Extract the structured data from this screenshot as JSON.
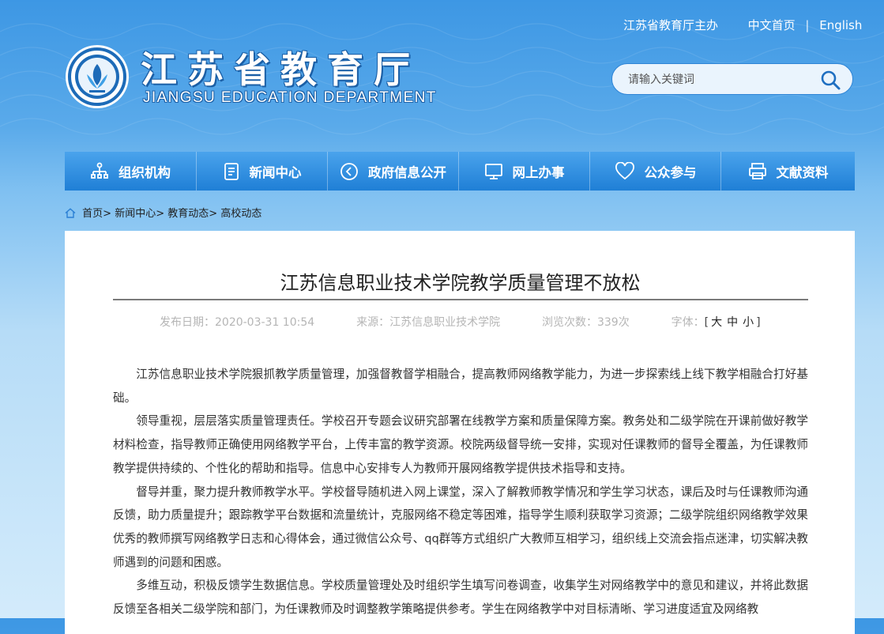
{
  "header": {
    "host_label": "江苏省教育厅主办",
    "home_cn": "中文首页",
    "separator": "|",
    "english": "English",
    "site_name": "江苏省教育厅",
    "site_name_en": "JIANGSU EDUCATION DEPARTMENT",
    "search_placeholder": "请输入关键词"
  },
  "nav": [
    {
      "label": "组织机构",
      "icon": "org-chart-icon"
    },
    {
      "label": "新闻中心",
      "icon": "document-icon"
    },
    {
      "label": "政府信息公开",
      "icon": "speaker-icon"
    },
    {
      "label": "网上办事",
      "icon": "monitor-icon"
    },
    {
      "label": "公众参与",
      "icon": "heart-icon"
    },
    {
      "label": "文献资料",
      "icon": "printer-icon"
    }
  ],
  "breadcrumb": {
    "home": "首页",
    "items": [
      "新闻中心",
      "教育动态",
      "高校动态"
    ],
    "sep": ">"
  },
  "article": {
    "title": "江苏信息职业技术学院教学质量管理不放松",
    "date_label": "发布日期：",
    "date": "2020-03-31 10:54",
    "source_label": "来源：",
    "source": "江苏信息职业技术学院",
    "views_label": "浏览次数：",
    "views": "339次",
    "font_label": "字体：",
    "font_sizes": [
      "大",
      "中",
      "小"
    ],
    "paragraphs": [
      "江苏信息职业技术学院狠抓教学质量管理，加强督教督学相融合，提高教师网络教学能力，为进一步探索线上线下教学相融合打好基础。",
      "领导重视，层层落实质量管理责任。学校召开专题会议研究部署在线教学方案和质量保障方案。教务处和二级学院在开课前做好教学材料检查，指导教师正确使用网络教学平台，上传丰富的教学资源。校院两级督导统一安排，实现对任课教师的督导全覆盖，为任课教师教学提供持续的、个性化的帮助和指导。信息中心安排专人为教师开展网络教学提供技术指导和支持。",
      "督导并重，聚力提升教师教学水平。学校督导随机进入网上课堂，深入了解教师教学情况和学生学习状态，课后及时与任课教师沟通反馈，助力质量提升；跟踪教学平台数据和流量统计，克服网络不稳定等困难，指导学生顺利获取学习资源；二级学院组织网络教学效果优秀的教师撰写网络教学日志和心得体会，通过微信公众号、qq群等方式组织广大教师互相学习，组织线上交流会指点迷津，切实解决教师遇到的问题和困惑。",
      "多维互动，积极反馈学生数据信息。学校质量管理处及时组织学生填写问卷调查，收集学生对网络教学中的意见和建议，并将此数据反馈至各相关二级学院和部门，为任课教师及时调整教学策略提供参考。学生在网络教学中对目标清晰、学习进度适宜及网络教"
    ]
  },
  "colors": {
    "nav_top": "#4aa3ec",
    "nav_bottom": "#1f7fd6",
    "header_bg": "#3d97e4"
  }
}
